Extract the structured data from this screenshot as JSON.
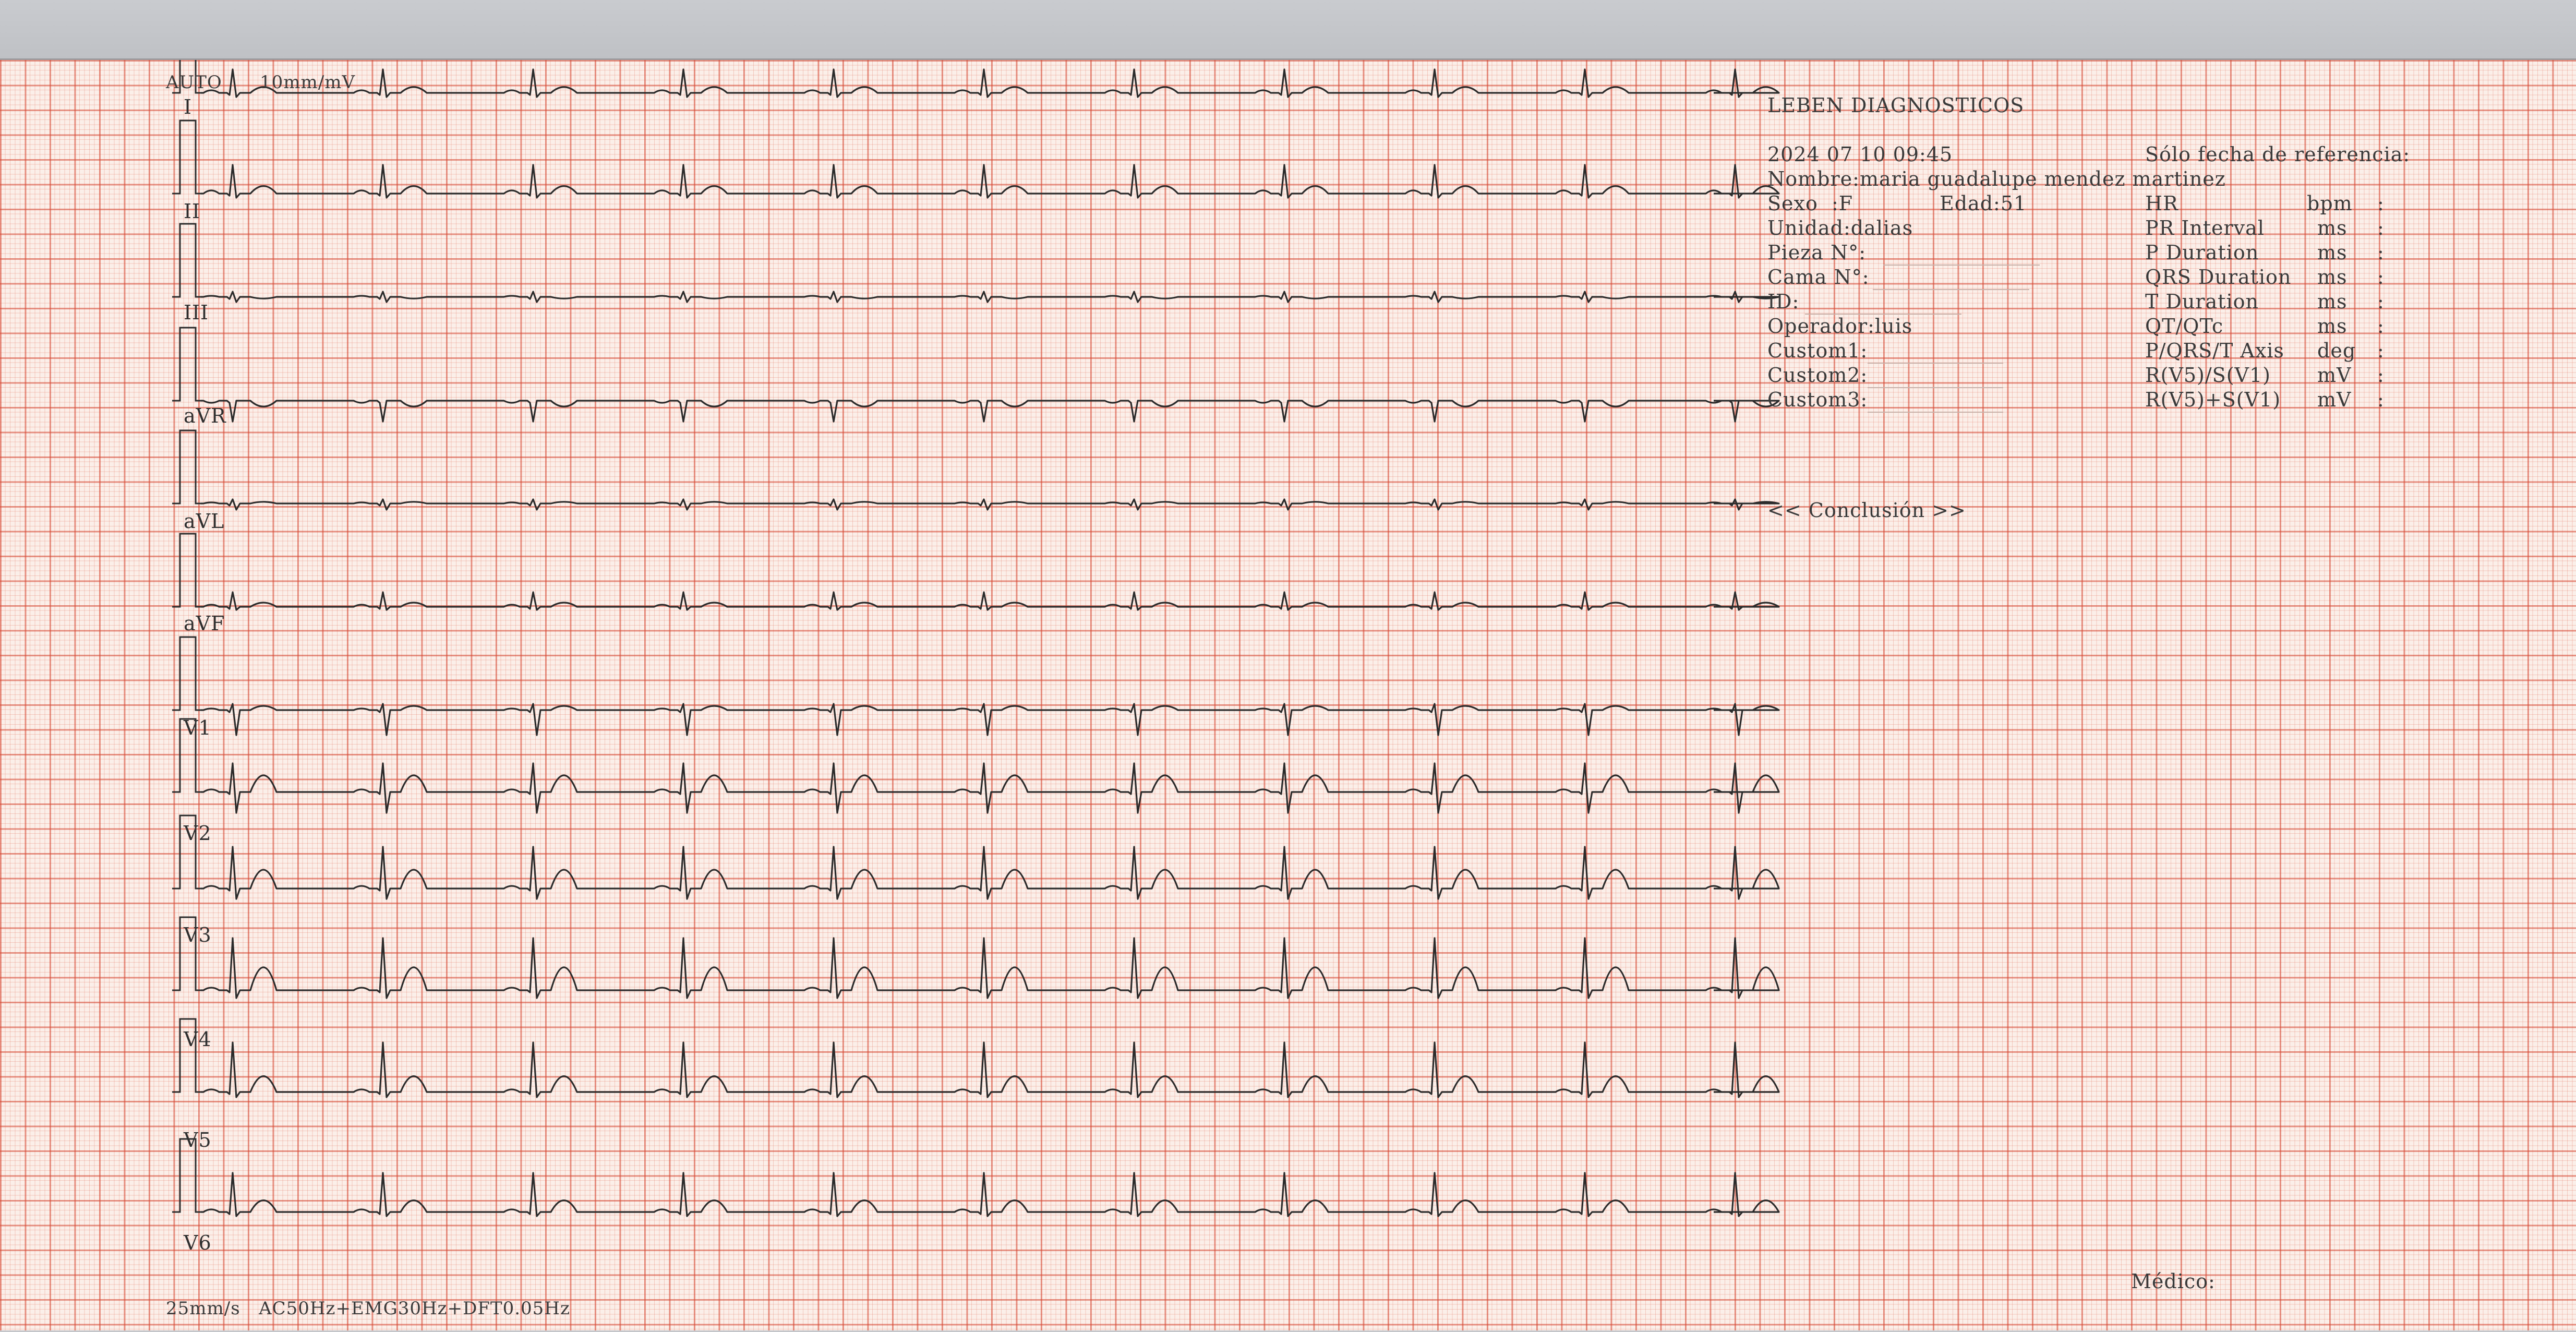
{
  "header": {
    "auto": "AUTO",
    "sensitivity": "10mm/mV",
    "footer_settings": "25mm/s   AC50Hz+EMG30Hz+DFT0.05Hz"
  },
  "leads": [
    "I",
    "II",
    "III",
    "aVR",
    "aVL",
    "aVF",
    "V1",
    "V2",
    "V3",
    "V4",
    "V5",
    "V6"
  ],
  "patient": {
    "clinic": "LEBEN DIAGNOSTICOS",
    "datetime": "2024 07 10 09:45",
    "reference_note": "Sólo fecha de referencia:",
    "name": "Nombre:maria guadalupe mendez martinez",
    "sex": "Sexo  :F",
    "age": "Edad:51",
    "unit": "Unidad:dalias",
    "room": "Pieza N°:",
    "bed": "Cama N°:",
    "id": "ID:",
    "operator": "Operador:luis",
    "custom1": "Custom1:",
    "custom2": "Custom2:",
    "custom3": "Custom3:"
  },
  "measurements": [
    {
      "label": "HR",
      "unit": "bpm"
    },
    {
      "label": "PR Interval",
      "unit": "ms"
    },
    {
      "label": "P Duration",
      "unit": "ms"
    },
    {
      "label": "QRS Duration",
      "unit": "ms"
    },
    {
      "label": "T Duration",
      "unit": "ms"
    },
    {
      "label": "QT/QTc",
      "unit": "ms"
    },
    {
      "label": "P/QRS/T Axis",
      "unit": "deg"
    },
    {
      "label": "R(V5)/S(V1)",
      "unit": "mV"
    },
    {
      "label": "R(V5)+S(V1)",
      "unit": "mV"
    }
  ],
  "measurement_separator": ":",
  "conclusion": "<< Conclusión >>",
  "physician": "Médico:",
  "colors": {
    "grid_major": "#d64834",
    "grid_minor": "#e47864",
    "paper": "#fbefe9",
    "trace": "#2b2b2b"
  }
}
